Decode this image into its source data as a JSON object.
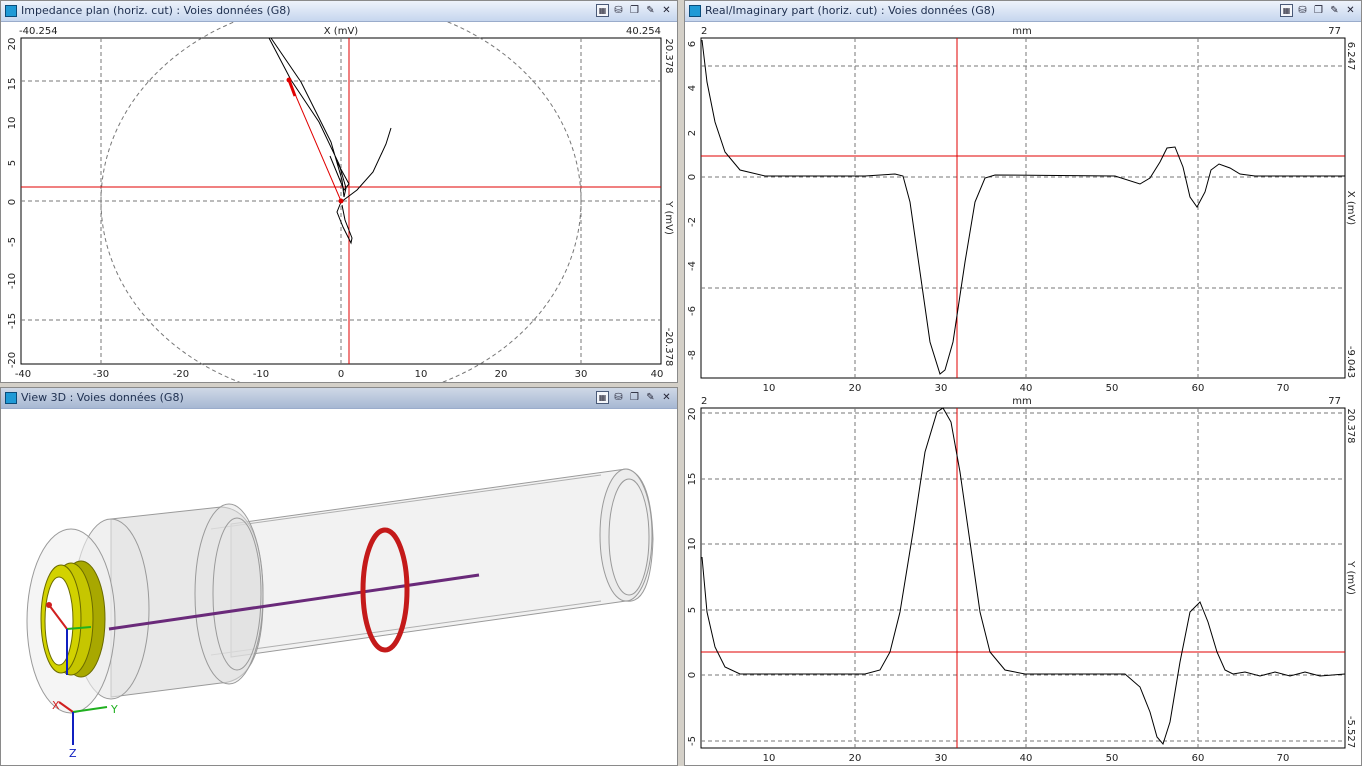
{
  "impedance_panel": {
    "title": "Impedance plan (horiz. cut)  : Voies données (G8)",
    "x_min_label": "-40.254",
    "x_max_label": "40.254",
    "x_axis_label": "X (mV)",
    "y_max_label": "20.378",
    "y_min_label": "-20.378",
    "y_axis_label": "Y (mV)",
    "x_ticks": [
      "-40",
      "-30",
      "-20",
      "-10",
      "0",
      "10",
      "20",
      "30",
      "40"
    ],
    "y_ticks": [
      "20",
      "15",
      "10",
      "5",
      "0",
      "-5",
      "-10",
      "-15",
      "-20"
    ]
  },
  "view3d_panel": {
    "title": "View 3D  : Voies données (G8)",
    "axes": {
      "x": "X",
      "y": "Y",
      "z": "Z"
    }
  },
  "realimag_panel": {
    "title": "Real/Imaginary part (horiz. cut)  : Voies données (G8)",
    "top": {
      "x_start": "2",
      "x_end": "77",
      "x_unit": "mm",
      "y_max_label": "6.247",
      "y_min_label": "-9.043",
      "y_axis_label": "X (mV)",
      "y_ticks": [
        "6",
        "4",
        "2",
        "0",
        "-2",
        "-4",
        "-6",
        "-8"
      ],
      "x_ticks": [
        "10",
        "20",
        "30",
        "40",
        "50",
        "60",
        "70"
      ]
    },
    "bottom": {
      "x_start": "2",
      "x_end": "77",
      "x_unit": "mm",
      "y_max_label": "20.378",
      "y_min_label": "-5.527",
      "y_axis_label": "Y (mV)",
      "y_ticks": [
        "20",
        "15",
        "10",
        "5",
        "0",
        "-5"
      ],
      "x_ticks": [
        "10",
        "20",
        "30",
        "40",
        "50",
        "60",
        "70"
      ]
    }
  },
  "colors": {
    "signal": "#000000",
    "cursor": "#e00000",
    "grid": "#666666",
    "probe_coil": "#9a9a00",
    "defect_ring": "#c41a1a",
    "scan_line": "#6a2a7a"
  }
}
